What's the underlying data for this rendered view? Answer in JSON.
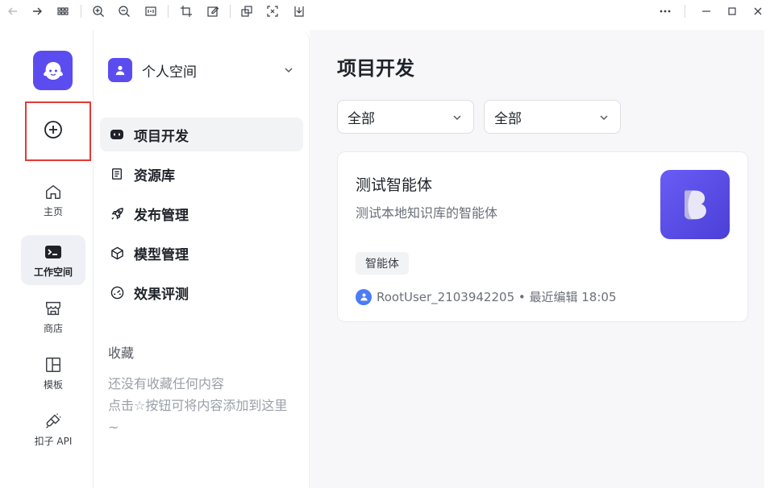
{
  "rail": {
    "items": [
      {
        "label": "主页",
        "icon": "home-icon"
      },
      {
        "label": "工作空间",
        "icon": "terminal-icon"
      },
      {
        "label": "商店",
        "icon": "store-icon"
      },
      {
        "label": "模板",
        "icon": "template-icon"
      },
      {
        "label": "扣子 API",
        "icon": "plugin-icon"
      }
    ],
    "active_index": 1
  },
  "sidebar": {
    "space_label": "个人空间",
    "nav": [
      {
        "label": "项目开发",
        "icon": "bot-icon"
      },
      {
        "label": "资源库",
        "icon": "library-icon"
      },
      {
        "label": "发布管理",
        "icon": "rocket-icon"
      },
      {
        "label": "模型管理",
        "icon": "cube-icon"
      },
      {
        "label": "效果评测",
        "icon": "gauge-icon"
      }
    ],
    "active_index": 0,
    "favorites_title": "收藏",
    "favorites_empty": "还没有收藏任何内容\n点击☆按钮可将内容添加到这里~"
  },
  "main": {
    "title": "项目开发",
    "filters": [
      {
        "value": "全部"
      },
      {
        "value": "全部"
      }
    ],
    "card": {
      "title": "测试智能体",
      "description": "测试本地知识库的智能体",
      "tag": "智能体",
      "meta": "RootUser_2103942205 • 最近编辑 18:05"
    }
  },
  "colors": {
    "brand": "#5b4cf0",
    "highlight": "#e53935"
  }
}
